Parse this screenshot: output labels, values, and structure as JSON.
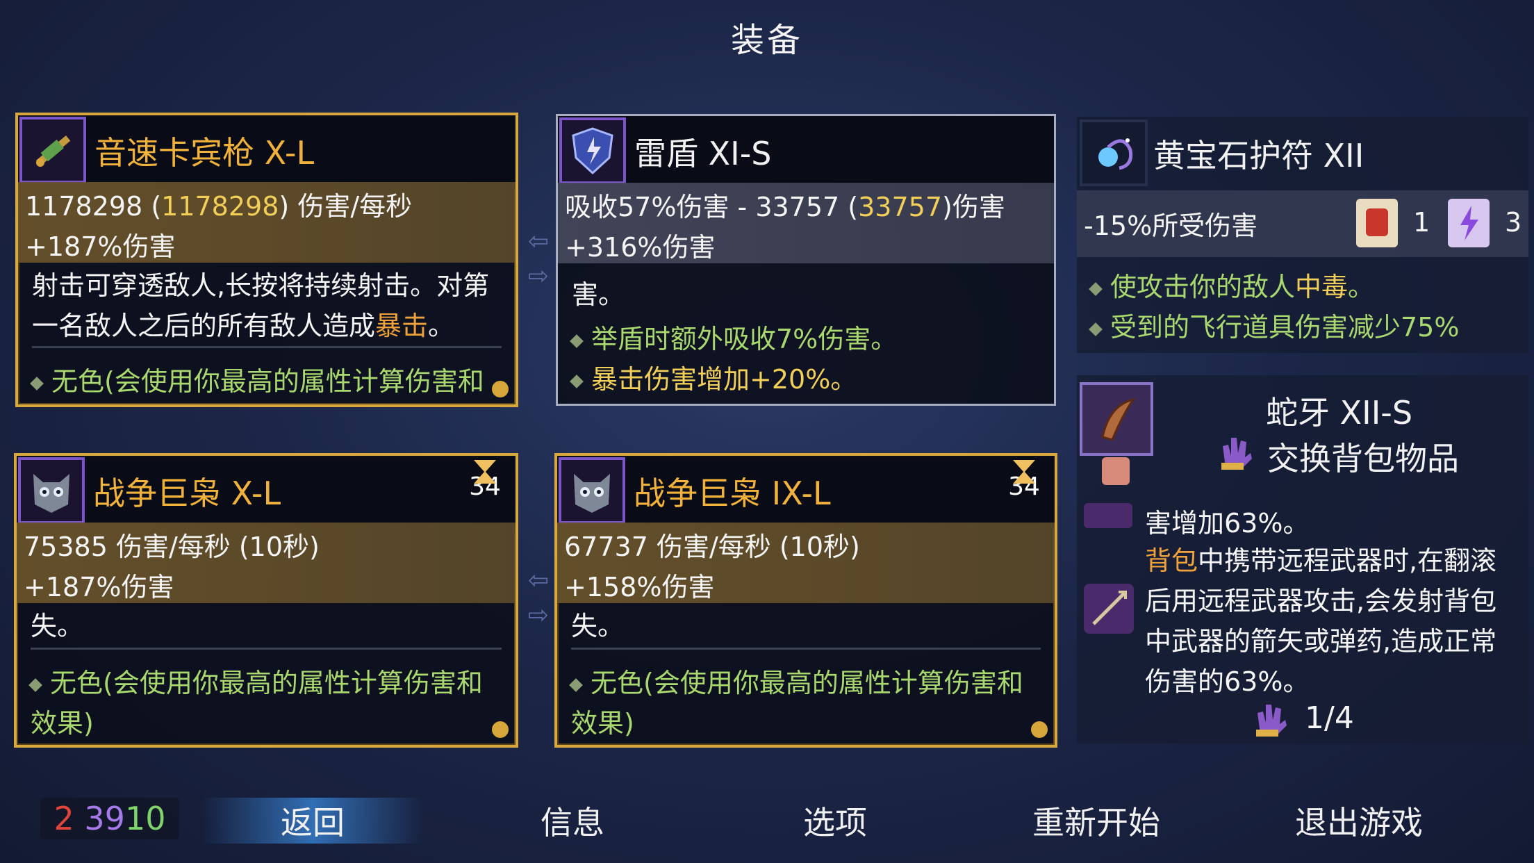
{
  "screen_title": "装备",
  "cards": {
    "carbine": {
      "name": "音速卡宾枪 X-L",
      "dps_value": "1178298",
      "dps_paren": "1178298",
      "dps_unit": "伤害/每秒",
      "bonus": "+187%伤害",
      "desc1": "射击可穿透敌人,长按将持续射击。对第",
      "desc2a": "一名敌人之后的所有敌人造成",
      "desc2b": "暴击",
      "desc2c": "。",
      "green": "无色(会使用你最高的属性计算伤害和"
    },
    "shield": {
      "name": "雷盾 XI-S",
      "absorb_a": "吸收57%伤害 - 33757 (",
      "absorb_b": "33757",
      "absorb_c": ")伤害",
      "bonus": "+316%伤害",
      "desc1": "害。",
      "green1": "举盾时额外吸收7%伤害。",
      "green2": "暴击伤害增加+20%。"
    },
    "amulet": {
      "name": "黄宝石护符 XII",
      "stat": "-15%所受伤害",
      "scroll1_count": "1",
      "scroll2_count": "3",
      "green1_a": "使攻击你的敌人",
      "green1_b": "中毒",
      "green1_c": "。",
      "green2": "受到的飞行道具伤害减少75%"
    },
    "owl1": {
      "name": "战争巨枭 X-L",
      "cooldown": "34",
      "dps": "75385 伤害/每秒 (10秒)",
      "bonus": "+187%伤害",
      "desc": "失。",
      "green1": "无色(会使用你最高的属性计算伤害和",
      "green2": "效果)"
    },
    "owl2": {
      "name": "战争巨枭 IX-L",
      "cooldown": "34",
      "dps": "67737 伤害/每秒 (10秒)",
      "bonus": "+158%伤害",
      "desc": "失。",
      "green1": "无色(会使用你最高的属性计算伤害和",
      "green2": "效果)"
    }
  },
  "fang": {
    "name": "蛇牙 XII-S",
    "swap_label": "交换背包物品",
    "line0": "害增加63%。",
    "line1_a": "背包",
    "line1_b": "中携带远程武器时,在翻滚",
    "line2": "后用远程武器攻击,会发射背包",
    "line3": "中武器的箭矢或弹药,造成正常",
    "line4": "伤害的63%。",
    "pages": "1/4"
  },
  "counter": {
    "red": "2",
    "purple": "39",
    "green": "10"
  },
  "menu": {
    "back": "返回",
    "info": "信息",
    "options": "选项",
    "restart": "重新开始",
    "quit": "退出游戏"
  },
  "colors": {
    "gold_border": "#d6a83e",
    "silver_border": "#a7aec4",
    "green_text": "#a9d86e",
    "yellow_text": "#f2cf58",
    "red": "#e0443a",
    "purple": "#a67ae8",
    "green": "#7ed36a"
  },
  "icons": [
    "carbine-icon",
    "thunder-shield-icon",
    "amulet-icon",
    "war-owl-icon",
    "hourglass-icon",
    "snake-fang-icon",
    "glove-icon",
    "fist-scroll-icon",
    "lightning-scroll-icon"
  ]
}
